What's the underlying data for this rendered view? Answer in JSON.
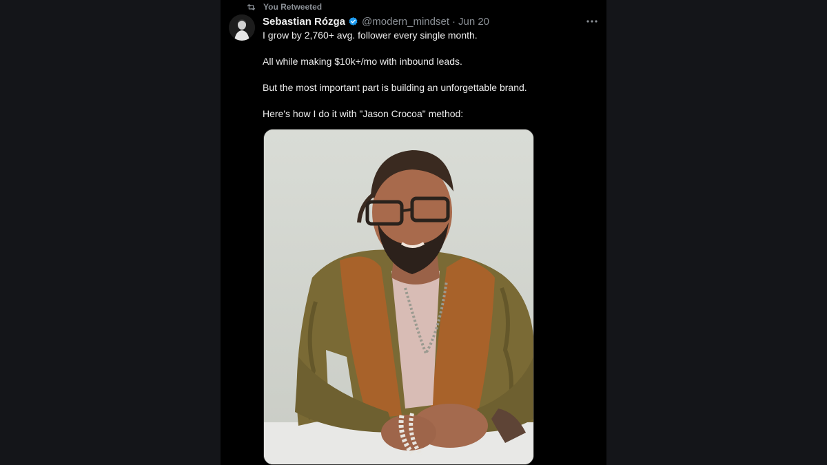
{
  "retweet": {
    "label": "You Retweeted",
    "icon": "retweet-icon"
  },
  "tweet": {
    "author_name": "Sebastian Rózga",
    "verified": true,
    "handle": "@modern_mindset",
    "separator": "·",
    "date": "Jun 20",
    "more_icon": "more-horizontal-icon",
    "paragraphs": [
      "I grow by 2,760+ avg. follower every single month.",
      "All while making $10k+/mo with inbound leads.",
      "But the most important part is building an unforgettable brand.",
      "Here's how I do it with \"Jason Crocoa\" method:"
    ],
    "media": {
      "kind": "photo",
      "subject": "portrait-photo"
    }
  },
  "colors": {
    "page_bg": "#141519",
    "panel_bg": "#000000",
    "primary_text": "#ececec",
    "secondary_text": "#8b9096",
    "verified_blue": "#1d9bf0"
  }
}
